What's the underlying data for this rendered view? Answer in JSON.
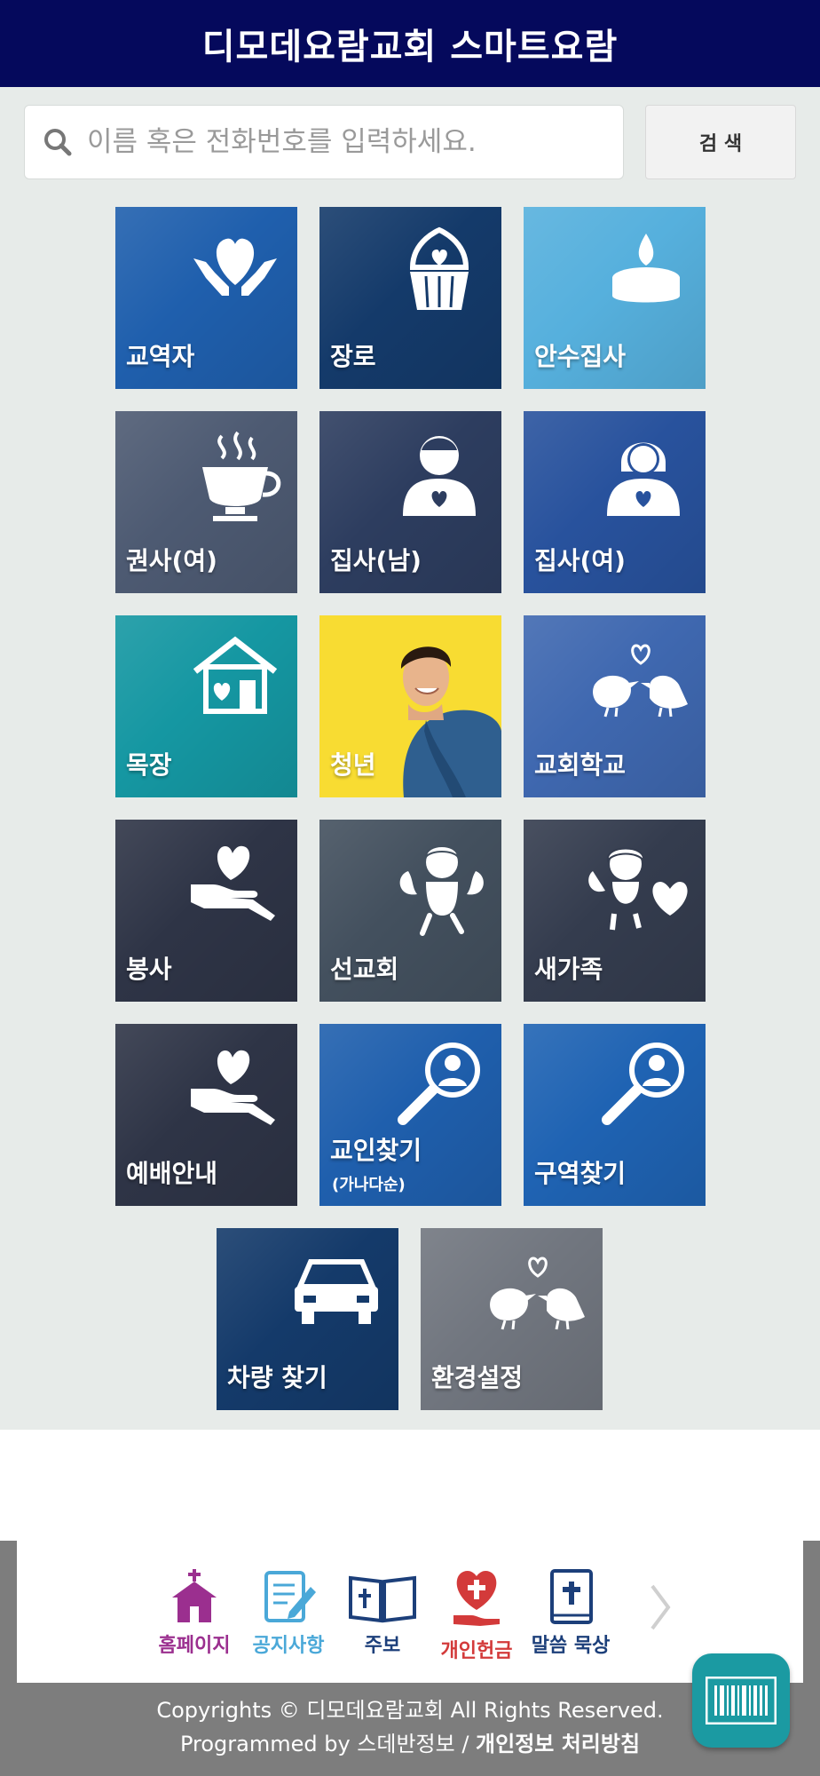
{
  "header": {
    "title": "디모데요람교회 스마트요람"
  },
  "search": {
    "placeholder": "이름 혹은 전화번호를 입력하세요.",
    "value": "",
    "button_label": "검 색"
  },
  "tiles": [
    {
      "label": "교역자",
      "icon": "heart-hands-icon",
      "color": "#1f5fad"
    },
    {
      "label": "장로",
      "icon": "cupcake-icon",
      "color": "#143a6a"
    },
    {
      "label": "안수집사",
      "icon": "candle-icon",
      "color": "#56b0dd"
    },
    {
      "label": "권사(여)",
      "icon": "coffee-cup-icon",
      "color": "#4d5a72"
    },
    {
      "label": "집사(남)",
      "icon": "man-heart-icon",
      "color": "#2d3d5f"
    },
    {
      "label": "집사(여)",
      "icon": "woman-heart-icon",
      "color": "#28529d"
    },
    {
      "label": "목장",
      "icon": "house-heart-icon",
      "color": "#1597a2"
    },
    {
      "label": "청년",
      "icon": "young-man-photo",
      "color": "#f8dc32"
    },
    {
      "label": "교회학교",
      "icon": "birds-heart-icon",
      "color": "#3f68b0"
    },
    {
      "label": "봉사",
      "icon": "heart-in-hand-icon",
      "color": "#2e3446"
    },
    {
      "label": "선교회",
      "icon": "angel-icon",
      "color": "#43505e"
    },
    {
      "label": "새가족",
      "icon": "cherub-heart-icon",
      "color": "#343c4e"
    },
    {
      "label": "예배안내",
      "icon": "heart-in-hand-icon",
      "color": "#2e3446"
    },
    {
      "label": "교인찾기",
      "sublabel": "(가나다순)",
      "icon": "magnifier-person-icon",
      "color": "#1f5fad"
    },
    {
      "label": "구역찾기",
      "icon": "magnifier-person-icon",
      "color": "#1f63b3"
    },
    {
      "label": "차량 찾기",
      "icon": "car-icon",
      "color": "#143a6a"
    },
    {
      "label": "환경설정",
      "icon": "birds-heart-icon",
      "color": "#71767f"
    }
  ],
  "bottom_nav": [
    {
      "label": "홈페이지",
      "icon": "church-icon",
      "color": "#9b2f8f"
    },
    {
      "label": "공지사항",
      "icon": "notepad-pencil-icon",
      "color": "#4aa8d8"
    },
    {
      "label": "주보",
      "icon": "open-bible-icon",
      "color": "#1c3f7a"
    },
    {
      "label": "개인헌금",
      "icon": "heart-cross-hand-icon",
      "color": "#d33a3a"
    },
    {
      "label": "말씀 묵상",
      "icon": "bible-book-icon",
      "color": "#1c3f7a"
    }
  ],
  "footer": {
    "copyright": "Copyrights © 디모데요람교회 All Rights Reserved.",
    "programmed_by": "Programmed by 스데반정보 / ",
    "privacy_link": "개인정보 처리방침"
  }
}
